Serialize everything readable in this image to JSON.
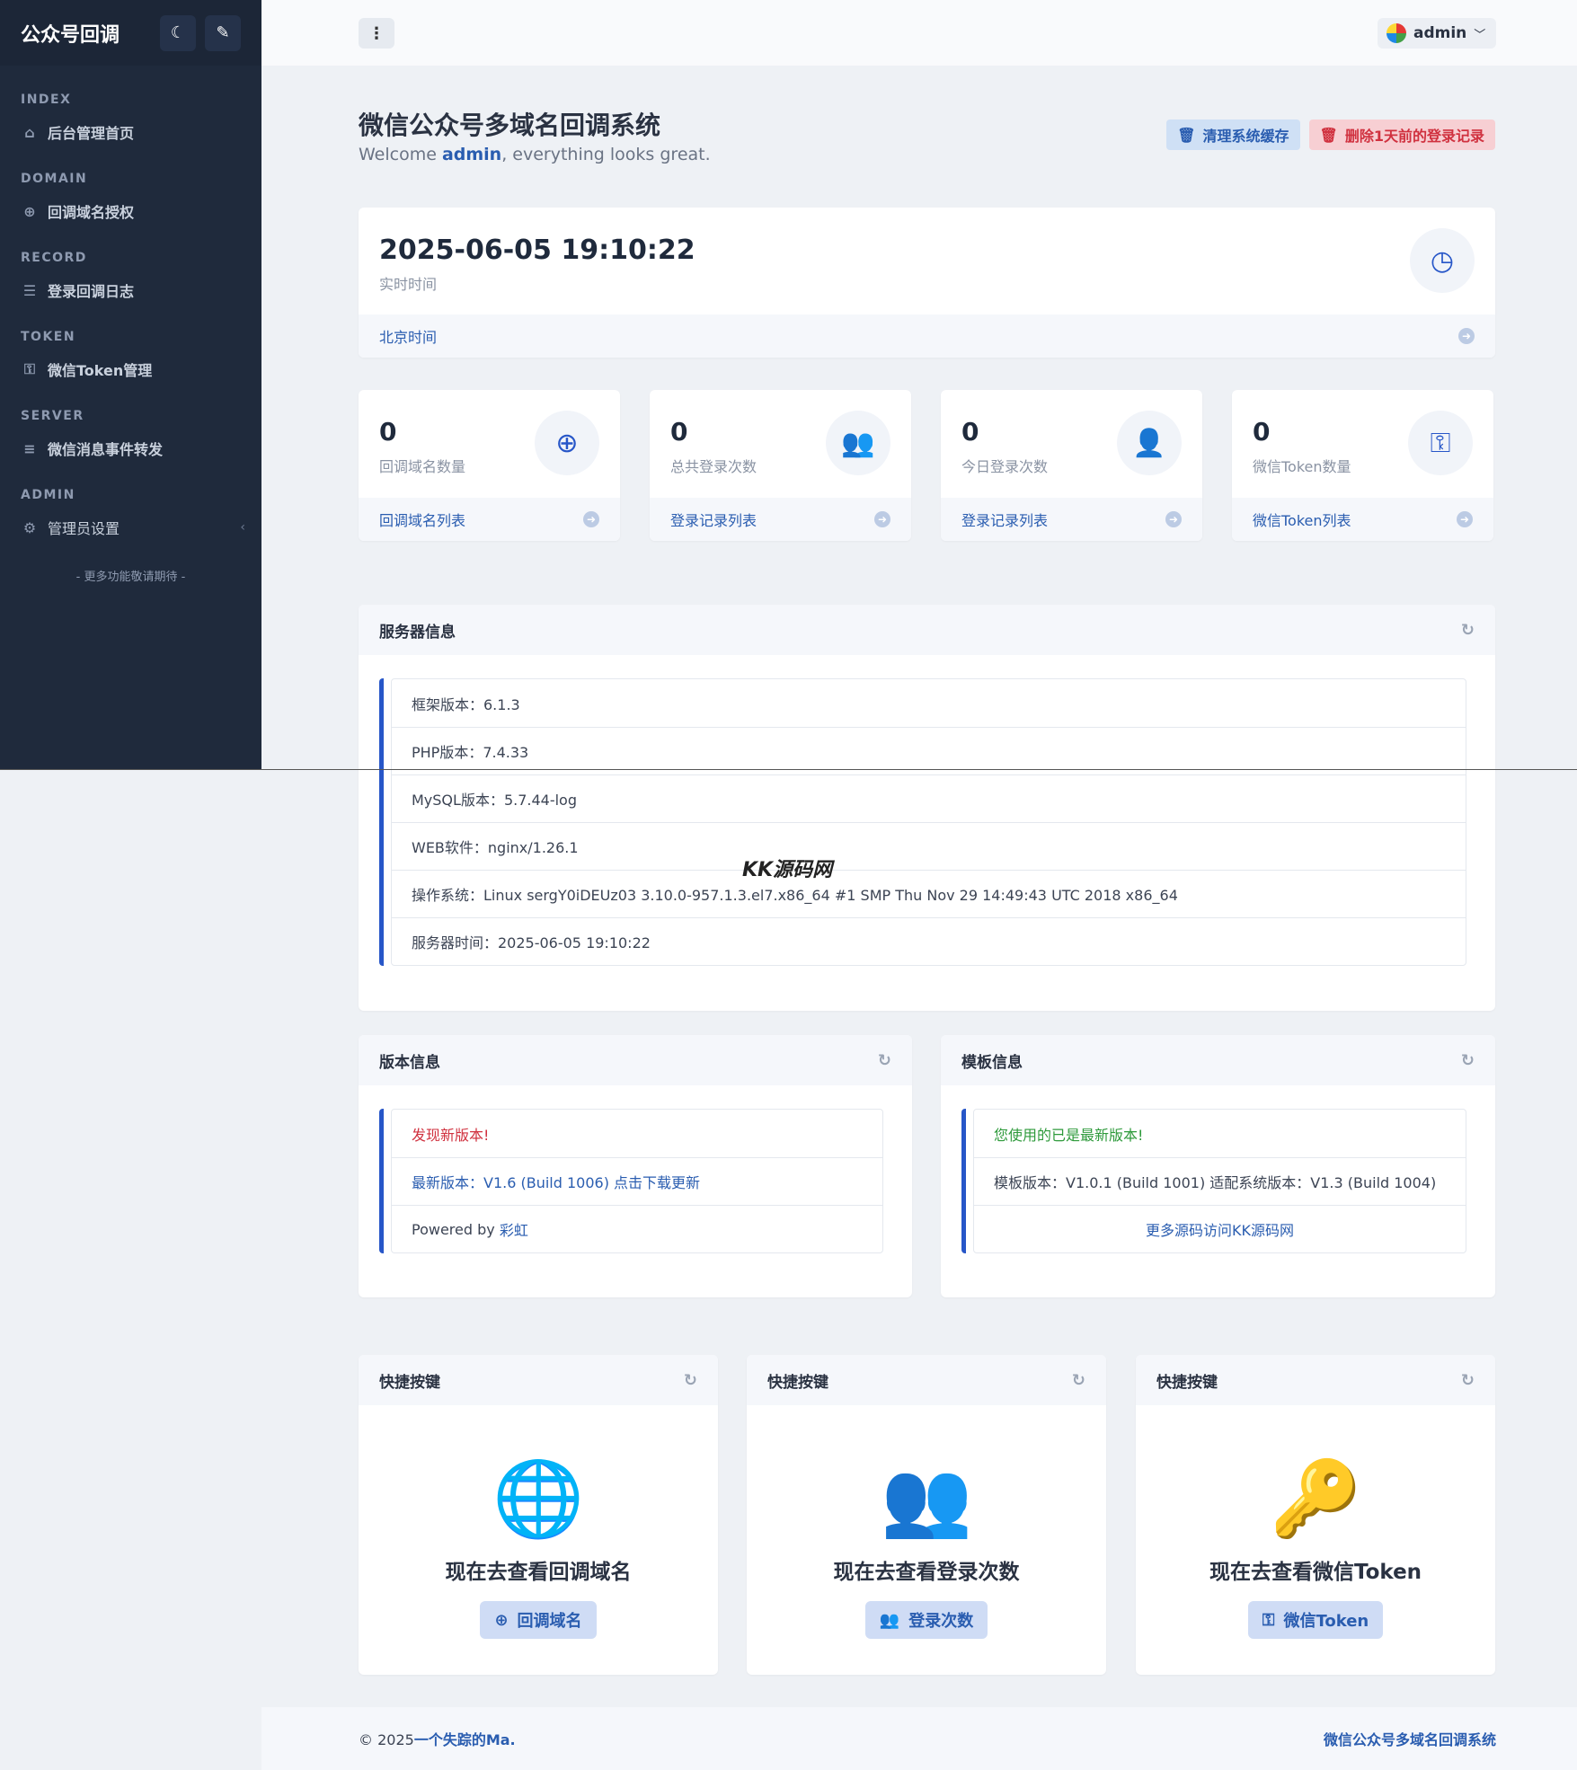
{
  "sidebar": {
    "brand": "公众号回调",
    "sections": [
      {
        "heading": "INDEX",
        "item": "后台管理首页",
        "icon": "home-icon"
      },
      {
        "heading": "DOMAIN",
        "item": "回调域名授权",
        "icon": "globe-icon"
      },
      {
        "heading": "RECORD",
        "item": "登录回调日志",
        "icon": "list-icon"
      },
      {
        "heading": "TOKEN",
        "item": "微信Token管理",
        "icon": "key-icon"
      },
      {
        "heading": "SERVER",
        "item": "微信消息事件转发",
        "icon": "server-icon"
      },
      {
        "heading": "ADMIN",
        "item": "管理员设置",
        "icon": "gear-icon"
      }
    ],
    "note": "- 更多功能敬请期待 -"
  },
  "header": {
    "user": "admin"
  },
  "page": {
    "title": "微信公众号多域名回调系统",
    "welcome_prefix": "Welcome ",
    "welcome_user": "admin",
    "welcome_suffix": ", everything looks great.",
    "btn_clear_cache": "清理系统缓存",
    "btn_delete_logs": "删除1天前的登录记录"
  },
  "time_card": {
    "value": "2025-06-05 19:10:22",
    "label": "实时时间",
    "footer": "北京时间"
  },
  "stats": [
    {
      "value": "0",
      "label": "回调域名数量",
      "footer": "回调域名列表",
      "icon": "globe-icon"
    },
    {
      "value": "0",
      "label": "总共登录次数",
      "footer": "登录记录列表",
      "icon": "users-icon"
    },
    {
      "value": "0",
      "label": "今日登录次数",
      "footer": "登录记录列表",
      "icon": "user-icon"
    },
    {
      "value": "0",
      "label": "微信Token数量",
      "footer": "微信Token列表",
      "icon": "key-icon"
    }
  ],
  "server_info": {
    "title": "服务器信息",
    "rows": [
      "框架版本：6.1.3",
      "PHP版本：7.4.33",
      "MySQL版本：5.7.44-log",
      "WEB软件：nginx/1.26.1",
      "操作系统：Linux sergY0iDEUz03 3.10.0-957.1.3.el7.x86_64 #1 SMP Thu Nov 29 14:49:43 UTC 2018 x86_64",
      "服务器时间：2025-06-05 19:10:22"
    ]
  },
  "version_info": {
    "title": "版本信息",
    "new_version": "发现新版本!",
    "latest": "最新版本：V1.6 (Build 1006) 点击下载更新",
    "powered_prefix": "Powered by ",
    "powered_link": "彩虹"
  },
  "template_info": {
    "title": "模板信息",
    "status": "您使用的已是最新版本!",
    "detail": "模板版本：V1.0.1 (Build 1001) 适配系统版本：V1.3 (Build 1004)",
    "more": "更多源码访问KK源码网"
  },
  "quick": [
    {
      "title": "快捷按键",
      "text": "现在去查看回调域名",
      "button": "回调域名",
      "icon": "globe-icon"
    },
    {
      "title": "快捷按键",
      "text": "现在去查看登录次数",
      "button": "登录次数",
      "icon": "users-icon"
    },
    {
      "title": "快捷按键",
      "text": "现在去查看微信Token",
      "button": "微信Token",
      "icon": "key-icon"
    }
  ],
  "watermark": "KK源码网",
  "footer": {
    "copy_prefix": "© 2025",
    "copy_link": "一个失踪的Ma.",
    "right": "微信公众号多域名回调系统"
  }
}
